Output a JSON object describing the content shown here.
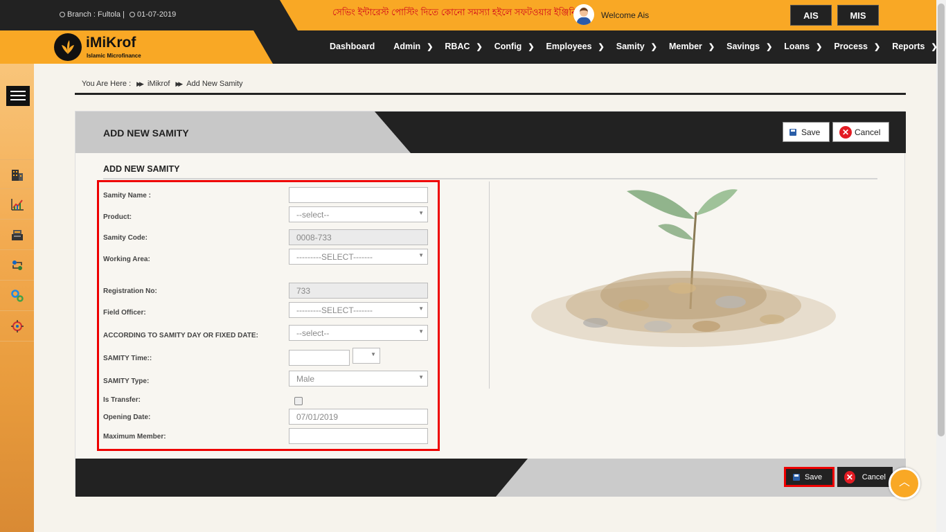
{
  "topbar": {
    "branch_label": "Branch : Fultola |",
    "date": "01-07-2019",
    "marquee": "সেভিং ইন্টারেস্ট পোস্টিং দিতে কোনো সমস্যা হইলে সফটওয়ার ইঞ্জিনি",
    "welcome": "Welcome Ais",
    "buttons": [
      "AIS",
      "MIS"
    ]
  },
  "brand": {
    "title": "iMiKrof",
    "subtitle": "Islamic Microfinance"
  },
  "nav": {
    "dashboard": "Dashboard",
    "admin": "Admin",
    "rbac": "RBAC",
    "config": "Config",
    "employees": "Employees",
    "samity": "Samity",
    "member": "Member",
    "savings": "Savings",
    "loans": "Loans",
    "process": "Process",
    "reports": "Reports"
  },
  "sidebar": {
    "icons": [
      "building-icon",
      "chart-growth-icon",
      "cash-register-icon",
      "hand-coins-icon",
      "gears-icon",
      "settings-dial-icon"
    ]
  },
  "breadcrumb": {
    "prefix": "You Are Here :",
    "items": [
      "iMikrof",
      "Add New Samity"
    ]
  },
  "panel": {
    "title": "ADD NEW SAMITY",
    "subtitle": "ADD NEW SAMITY",
    "save_label": "Save",
    "cancel_label": "Cancel"
  },
  "form": {
    "samity_name": {
      "label": "Samity Name :",
      "value": ""
    },
    "product": {
      "label": "Product:",
      "value": "--select--"
    },
    "samity_code": {
      "label": "Samity Code:",
      "value": "0008-733"
    },
    "working_area": {
      "label": "Working Area:",
      "value": "---------SELECT-------"
    },
    "registration_no": {
      "label": "Registration No:",
      "value": "733"
    },
    "field_officer": {
      "label": "Field Officer:",
      "value": "---------SELECT-------"
    },
    "samity_day": {
      "label": "ACCORDING TO SAMITY DAY OR FIXED DATE:",
      "value": "--select--"
    },
    "samity_time": {
      "label": "SAMITY Time::",
      "value": "",
      "period": ""
    },
    "samity_type": {
      "label": "SAMITY Type:",
      "value": "Male"
    },
    "is_transfer": {
      "label": "Is Transfer:",
      "checked": false
    },
    "opening_date": {
      "label": "Opening Date:",
      "value": "07/01/2019"
    },
    "maximum_member": {
      "label": "Maximum Member:",
      "value": ""
    }
  },
  "colors": {
    "accent": "#f9a825",
    "dark": "#222222",
    "highlight": "#e00000",
    "save_icon": "#2a5ea8",
    "cancel_icon": "#e31b23"
  }
}
